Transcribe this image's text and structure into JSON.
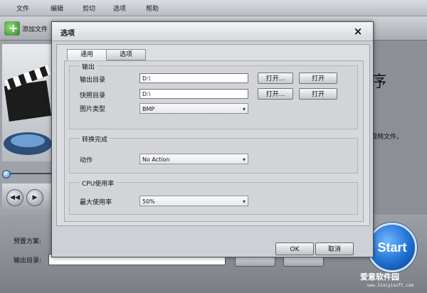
{
  "menu": [
    "文件",
    "编辑",
    "剪切",
    "选项",
    "帮助"
  ],
  "toolbar": {
    "add_file_label": "添加文件"
  },
  "background": {
    "preset_label": "预置方案:",
    "output_dir_label": "输出目录:",
    "right_partial_text": "视频文件。",
    "right_partial_heading": "序",
    "start_label": "Start"
  },
  "watermark": {
    "main": "爱意软件园",
    "sub": "www.52aiyisoft.com"
  },
  "dialog": {
    "title": "选项",
    "close": "×",
    "tabs": [
      "通用",
      "选项"
    ],
    "output_group": {
      "title": "输出",
      "output_dir": {
        "label": "输出目录",
        "value": "D:\\",
        "browse": "打开...",
        "open": "打开"
      },
      "snapshot_dir": {
        "label": "快照目录",
        "value": "D:\\",
        "browse": "打开...",
        "open": "打开"
      },
      "image_type": {
        "label": "图片类型",
        "value": "BMP"
      }
    },
    "convert_done_group": {
      "title": "转换完成",
      "action": {
        "label": "动作",
        "value": "No Action"
      }
    },
    "cpu_group": {
      "title": "CPU使用率",
      "max_usage": {
        "label": "最大使用率",
        "value": "50%"
      }
    },
    "ok": "OK",
    "cancel": "取消"
  }
}
